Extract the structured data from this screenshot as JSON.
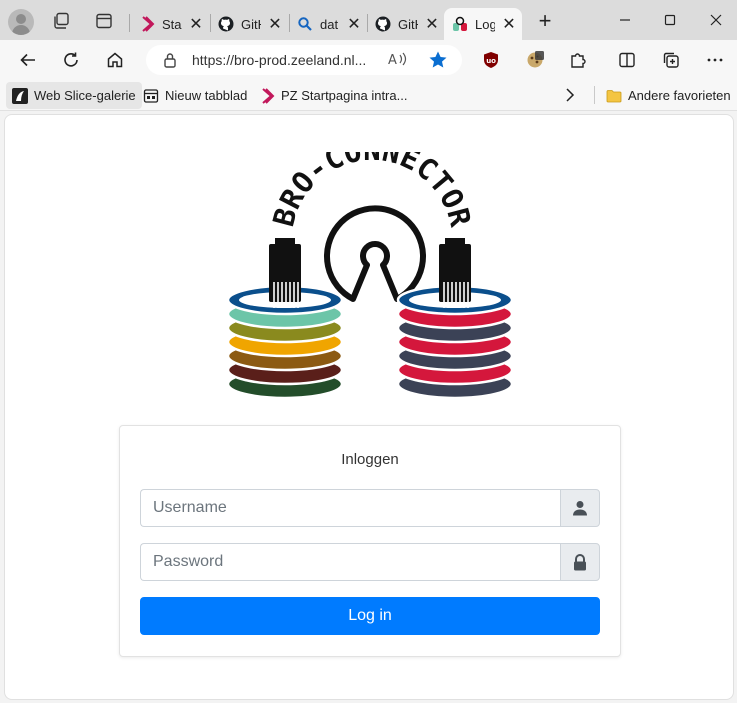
{
  "browser": {
    "tabs": [
      {
        "label": "Star",
        "favicon": "pz-logo-icon"
      },
      {
        "label": "GitH",
        "favicon": "github-icon"
      },
      {
        "label": "dat",
        "favicon": "search-icon"
      },
      {
        "label": "GitH",
        "favicon": "github-icon"
      },
      {
        "label": "Log",
        "favicon": "bro-connector-icon",
        "active": true
      }
    ],
    "tab_close": "✕",
    "new_tab": "+",
    "address": {
      "url": "https://bro-prod.zeeland.nl...",
      "read_aloud": "A)"
    },
    "favorites": [
      {
        "label": "Web Slice-galerie",
        "icon": "web-slice-icon"
      },
      {
        "label": "Nieuw tabblad",
        "icon": "new-tab-page-icon"
      },
      {
        "label": "PZ Startpagina intra...",
        "icon": "pz-logo-icon"
      }
    ],
    "other_favorites": "Andere favorieten"
  },
  "logo": {
    "text": "BRO-CONNECTOR"
  },
  "login": {
    "title": "Inloggen",
    "username_placeholder": "Username",
    "password_placeholder": "Password",
    "submit_label": "Log in"
  },
  "colors": {
    "primary": "#007bff",
    "left_stack": [
      "#0b4f8c",
      "#6cc5a8",
      "#8a8a1e",
      "#f0a500",
      "#8c5a12",
      "#5a1f1a",
      "#234d2a"
    ],
    "right_stack": [
      "#0b4f8c",
      "#d4173c",
      "#3b4256",
      "#d4173c",
      "#3b4256",
      "#d4173c",
      "#3b4256"
    ]
  }
}
